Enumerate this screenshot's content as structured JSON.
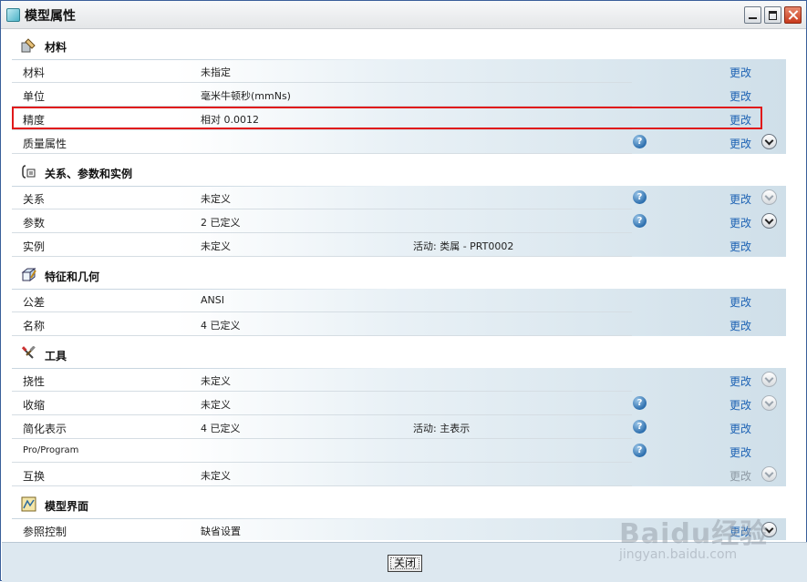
{
  "window": {
    "title": "模型属性"
  },
  "sections": {
    "material": {
      "title": "材料"
    },
    "relations": {
      "title": "关系、参数和实例"
    },
    "features": {
      "title": "特征和几何"
    },
    "tools": {
      "title": "工具"
    },
    "interface": {
      "title": "模型界面"
    }
  },
  "change_label": "更改",
  "rows": {
    "material": {
      "label": "材料",
      "value": "未指定"
    },
    "units": {
      "label": "单位",
      "value": "毫米牛顿秒(mmNs)"
    },
    "accuracy": {
      "label": "精度",
      "value": "相对 0.0012"
    },
    "mass_props": {
      "label": "质量属性",
      "value": ""
    },
    "relations": {
      "label": "关系",
      "value": "未定义"
    },
    "parameters": {
      "label": "参数",
      "value": "2 已定义"
    },
    "instances": {
      "label": "实例",
      "value": "未定义",
      "extra": "活动: 类属 - PRT0002"
    },
    "tolerance": {
      "label": "公差",
      "value": "ANSI"
    },
    "names": {
      "label": "名称",
      "value": "4 已定义"
    },
    "flexibility": {
      "label": "挠性",
      "value": "未定义"
    },
    "shrinkage": {
      "label": "收缩",
      "value": "未定义"
    },
    "simplified_rep": {
      "label": "简化表示",
      "value": "4 已定义",
      "extra": "活动: 主表示"
    },
    "pro_program": {
      "label": "Pro/Program",
      "value": ""
    },
    "interchange": {
      "label": "互换",
      "value": "未定义"
    },
    "reference_control": {
      "label": "参照控制",
      "value": "缺省设置"
    }
  },
  "footer": {
    "close_label": "关闭"
  },
  "watermark": {
    "main": "Baidu经验",
    "sub": "jingyan.baidu.com"
  },
  "colors": {
    "link": "#1e63b4",
    "highlight": "#e0191a",
    "footer_bg": "#dde8f0"
  }
}
